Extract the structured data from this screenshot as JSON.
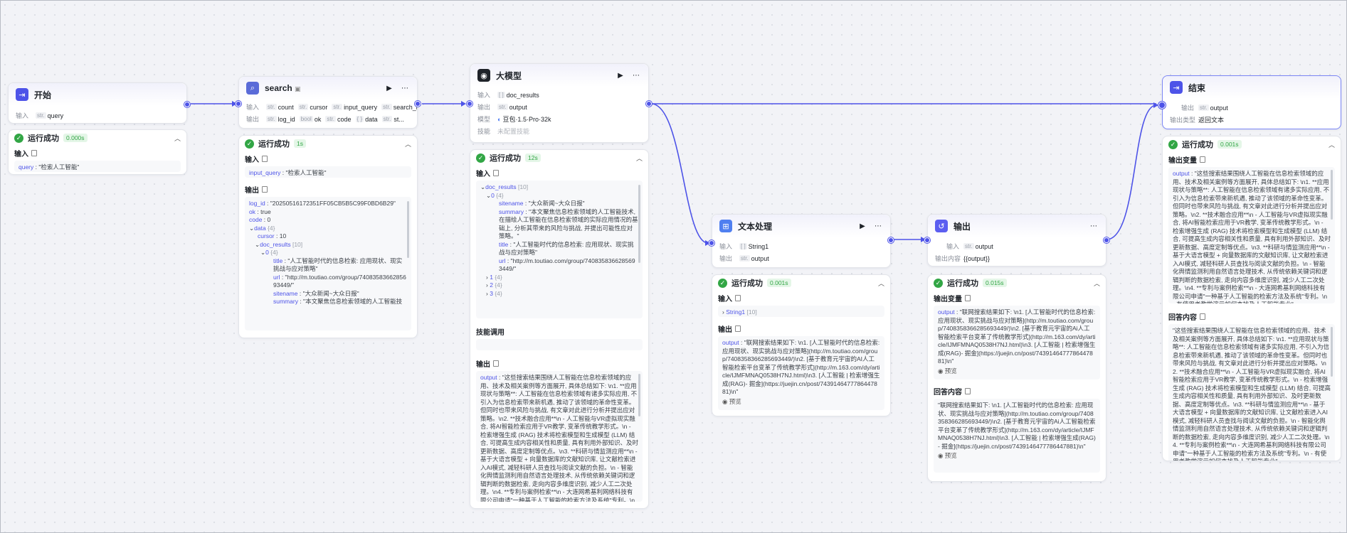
{
  "colors": {
    "accent": "#4d53e8",
    "success": "#32a645",
    "edge": "#4d53e8"
  },
  "common": {
    "input_label": "输入",
    "output_label": "输出",
    "success_label": "运行成功",
    "preview_label": "预览",
    "output_var_label": "输出变量",
    "answer_content_label": "回答内容",
    "copy_icon": "copy-icon",
    "run_icon": "play-icon",
    "more_icon": "more-icon",
    "collapse_icon": "chevron-up-icon"
  },
  "start": {
    "title": "开始",
    "input_param": "query",
    "run": {
      "duration": "0.000s",
      "input_label": "输入",
      "value_key": "query",
      "value": "\"检索人工智能\""
    }
  },
  "search": {
    "title": "search",
    "inputs": [
      {
        "type": "str.",
        "name": "count"
      },
      {
        "type": "str.",
        "name": "cursor"
      },
      {
        "type": "str.",
        "name": "input_query"
      },
      {
        "type": "str.",
        "name": "search_id"
      }
    ],
    "outputs": [
      {
        "type": "str.",
        "name": "log_id"
      },
      {
        "type": "bool",
        "name": "ok"
      },
      {
        "type": "str.",
        "name": "code"
      },
      {
        "type": "{ }",
        "name": "data"
      },
      {
        "type": "str.",
        "name": "st..."
      }
    ],
    "run": {
      "duration": "1s",
      "input_key": "input_query",
      "input_value": "\"检索人工智能\"",
      "log_id": "\"20250516172351FF05CB5B5C99F0BD6B29\"",
      "ok": "true",
      "code": "0",
      "data_key": "data",
      "data_count": "{4}",
      "cursor": "10",
      "doc_results_key": "doc_results",
      "doc_results_count": "[10]",
      "item0_key": "0",
      "item0_count": "{4}",
      "title": "\"人工智能时代的信息检索: 应用现状、现实挑战与应对策略\"",
      "url": "\"http://m.toutiao.com/group/7408358366285693449/\"",
      "sitename": "\"大众新闻~大众日报\"",
      "summary": "\"本文聚焦信息检索领域的人工智能技"
    }
  },
  "llm": {
    "title": "大模型",
    "input_var": "doc_results",
    "output_var": "output",
    "model_label": "模型",
    "model_name": "豆包·1.5·Pro·32k",
    "skills_label": "技能",
    "skills_value": "未配置技能",
    "run": {
      "duration": "12s",
      "doc_results_key": "doc_results",
      "doc_results_count": "[10]",
      "item0_key": "0",
      "item0_count": "{4}",
      "sitename": "\"大众新闻~大众日报\"",
      "summary": "\"本文聚焦信息检索领域的人工智能技术, 在描绘人工智能在信息检索领域的实际应用情况的基础上, 分析其带来的风险与挑战, 并提出可能性应对策略。\"",
      "title": "\"人工智能时代的信息检索: 应用现状、现实挑战与应对策略\"",
      "url": "\"http://m.toutiao.com/group/7408358366285693449/\"",
      "item1": "1",
      "item2": "2",
      "item3": "3",
      "item_count": "{4}",
      "skill_call_label": "技能调用",
      "output_key": "output",
      "output_value": "\"这些搜索结果围绕人工智能在信息检索领域的应用、技术及相关案例等方面展开, 具体总结如下: \\n1. **应用现状与策略**: 人工智能在信息检索领域有诸多实际应用, 不引入为信息检索带来新机遇, 推动了该领域的革命性变革。但同时也带来风险与挑战, 有文章对此进行分析并提出应对策略。\\n2. **技术融合应用**\\n - 人工智能与VR虚拟现实融合, 将AI智能检索应用于VR教学, 变革传统教学形式。\\n - 检索增强生成 (RAG) 技术将检索模型和生成模型 (LLM) 结合, 可提高生成内容相关性和质量, 具有利用外部知识、及时更新数据、高度定制等优点。\\n3. **科研与情监测应用**\\n - 基于大语言模型 + 向量数据库的文献知识库, 让文献检索进入AI模式, 减轻科研人员查找与阅读文献的负担。\\n - 智能化舆情监测利用自然语言处理技术, 从传统依赖关键词和逻辑判断的数据检索, 走向内容多维度识别, 减少人工二次处理。\\n4. **专利与案例检索**\\n - 大连网希基利网络科技有限公司申请\"一种基于人工智能的检索方法及系统\"专利。\\n - 有使用者教学演示如何查找及人工智能专业\""
    }
  },
  "text": {
    "title": "文本处理",
    "input_var": "String1",
    "output_var": "output",
    "run": {
      "duration": "0.001s",
      "input_item": "String1",
      "input_count": "[10]",
      "output_key": "output",
      "output_value": "\"联网搜索结果如下: \\n1. [人工智能时代的信息检索: 应用现状、现实挑战与应对策略](http://m.toutiao.com/group/7408358366285693449/)\\n2. [基于教育元宇宙的AI人工智能检索平台变革了传统教学形式](http://m.163.com/dy/article/IJMFMNAQ0538H7NJ.html)\\n3. [人工智能 | 检索增强生成(RAG)- 掘金](https://juejin.cn/post/7439146477786447881)\\n\""
    }
  },
  "output_node": {
    "title": "输出",
    "output_var": "output",
    "content_label": "输出内容",
    "content_value": "{{output}}",
    "run": {
      "duration": "0.015s",
      "var_output_key": "output",
      "var_output_value": "\"联网搜索结果如下: \\n1. [人工智能时代的信息检索: 应用现状、现实挑战与应对策略](http://m.toutiao.com/group/7408358366285693449/)\\n2. [基于教育元宇宙的Ai人工智能检索平台变革了传统教学形式](http://m.163.com/dy/article/IJMFMNAQ0538H7NJ.html)\\n3. [人工智能 | 检索增强生成(RAG)- 掘金](https://juejin.cn/post/7439146477786447881)\\n\"",
      "answer_value": "\"联网搜索结果如下: \\n1. [人工智能时代的信息检索: 应用现状、现实挑战与应对策略](http://m.toutiao.com/group/7408358366285693449/)\\n2. [基于教育元宇宙的Ai人工智能检索平台变革了传统教学形式](http://m.163.com/dy/article/IJMFMNAQ0538H7NJ.html)\\n3. [人工智能 | 检索增强生成(RAG)- 掘金](https://juejin.cn/post/7439146477786447881)\\n\""
    }
  },
  "end": {
    "title": "结束",
    "output_var": "output",
    "output_type_label": "输出类型",
    "output_type_value": "返回文本",
    "run": {
      "duration": "0.001s",
      "output_key": "output",
      "output_value": "\"这些搜索结果围绕人工智能在信息检索领域的应用、技术及相关案例等方面展开, 具体总结如下: \\n1. **应用现状与策略**: 人工智能在信息检索领域有诸多实际应用, 不引入为信息检索带来新机遇, 推动了该领域的革命性变革。但同时也带来风险与挑战, 有文章对此进行分析并提出应对策略。\\n2. **技术融合应用**\\n - 人工智能与VR虚拟现实融合, 将AI智能检索应用于VR教学, 变革传统教学形式。\\n - 检索增强生成 (RAG) 技术将检索模型和生成模型 (LLM) 结合, 可提高生成内容相关性和质量, 具有利用外部知识、及时更新数据、高度定制等优点。\\n3. **科研与情监测应用**\\n - 基于大语言模型 + 向量数据库的文献知识库, 让文献检索进入AI模式, 减轻科研人员查找与阅读文献的负担。\\n - 智能化舆情监测利用自然语言处理技术, 从传统依赖关键词和逻辑判断的数据检索, 走向内容多维度识别, 减少人工二次处理。\\n4. **专利与案例检索**\\n - 大连网希基利网络科技有限公司申请\"一种基于人工智能的检索方法及系统\"专利。\\n - 有使用者教学演示如何查找及人工智能专业\"",
      "answer_value": "\"这些搜索结果围绕人工智能在信息检索领域的应用、技术及相关案例等方面展开, 具体总结如下: \\n1. **应用现状与策略**: 人工智能在信息检索领域有诸多实际应用, 不引入为信息检索带来新机遇, 推动了该领域的革命性变革。但同时也带来风险与挑战, 有文章对此进行分析并提出应对策略。\\n2. **技术融合应用**\\n - 人工智能与VR虚拟现实融合, 将AI智能检索应用于VR教学, 变革传统教学形式。\\n - 检索增强生成 (RAG) 技术将检索模型和生成模型 (LLM) 结合, 可提高生成内容相关性和质量, 具有利用外部知识、及时更新数据、高度定制等优点。\\n3. **科研与情监测应用**\\n - 基于大语言模型 + 向量数据库的文献知识库, 让文献检索进入AI模式, 减轻科研人员查找与阅读文献的负担。\\n - 智能化舆情监测利用自然语言处理技术, 从传统依赖关键词和逻辑判断的数据检索, 走向内容多维度识别, 减少人工二次处理。\\n4. **专利与案例检索**\\n - 大连网希基利网络科技有限公司申请\"一种基于人工智能的检索方法及系统\"专利。\\n - 有使用者教学演示如何查找及人工智能专业\""
    }
  }
}
